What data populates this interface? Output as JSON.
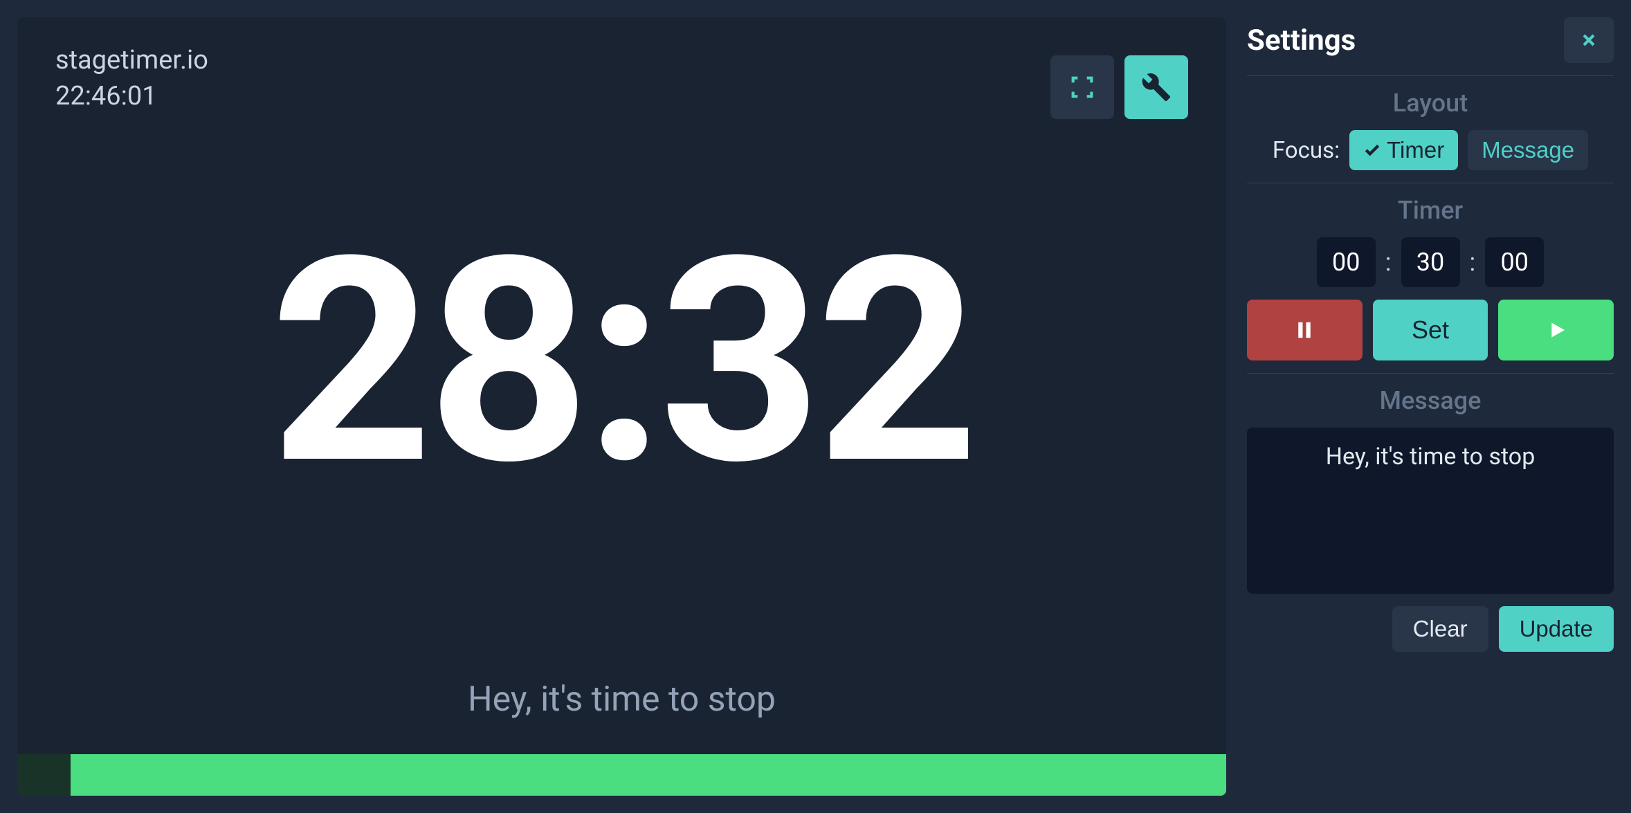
{
  "header": {
    "brand": "stagetimer.io",
    "clock": "22:46:01"
  },
  "timer_display": "28:32",
  "message_display": "Hey, it's time to stop",
  "progress": {
    "elapsed_percent": 4.4
  },
  "settings": {
    "title": "Settings",
    "layout": {
      "label": "Layout",
      "focus_label": "Focus:",
      "timer_option": "Timer",
      "message_option": "Message"
    },
    "timer": {
      "label": "Timer",
      "hours": "00",
      "minutes": "30",
      "seconds": "00",
      "set_label": "Set"
    },
    "message": {
      "label": "Message",
      "text": "Hey, it's time to stop",
      "clear_label": "Clear",
      "update_label": "Update"
    }
  }
}
